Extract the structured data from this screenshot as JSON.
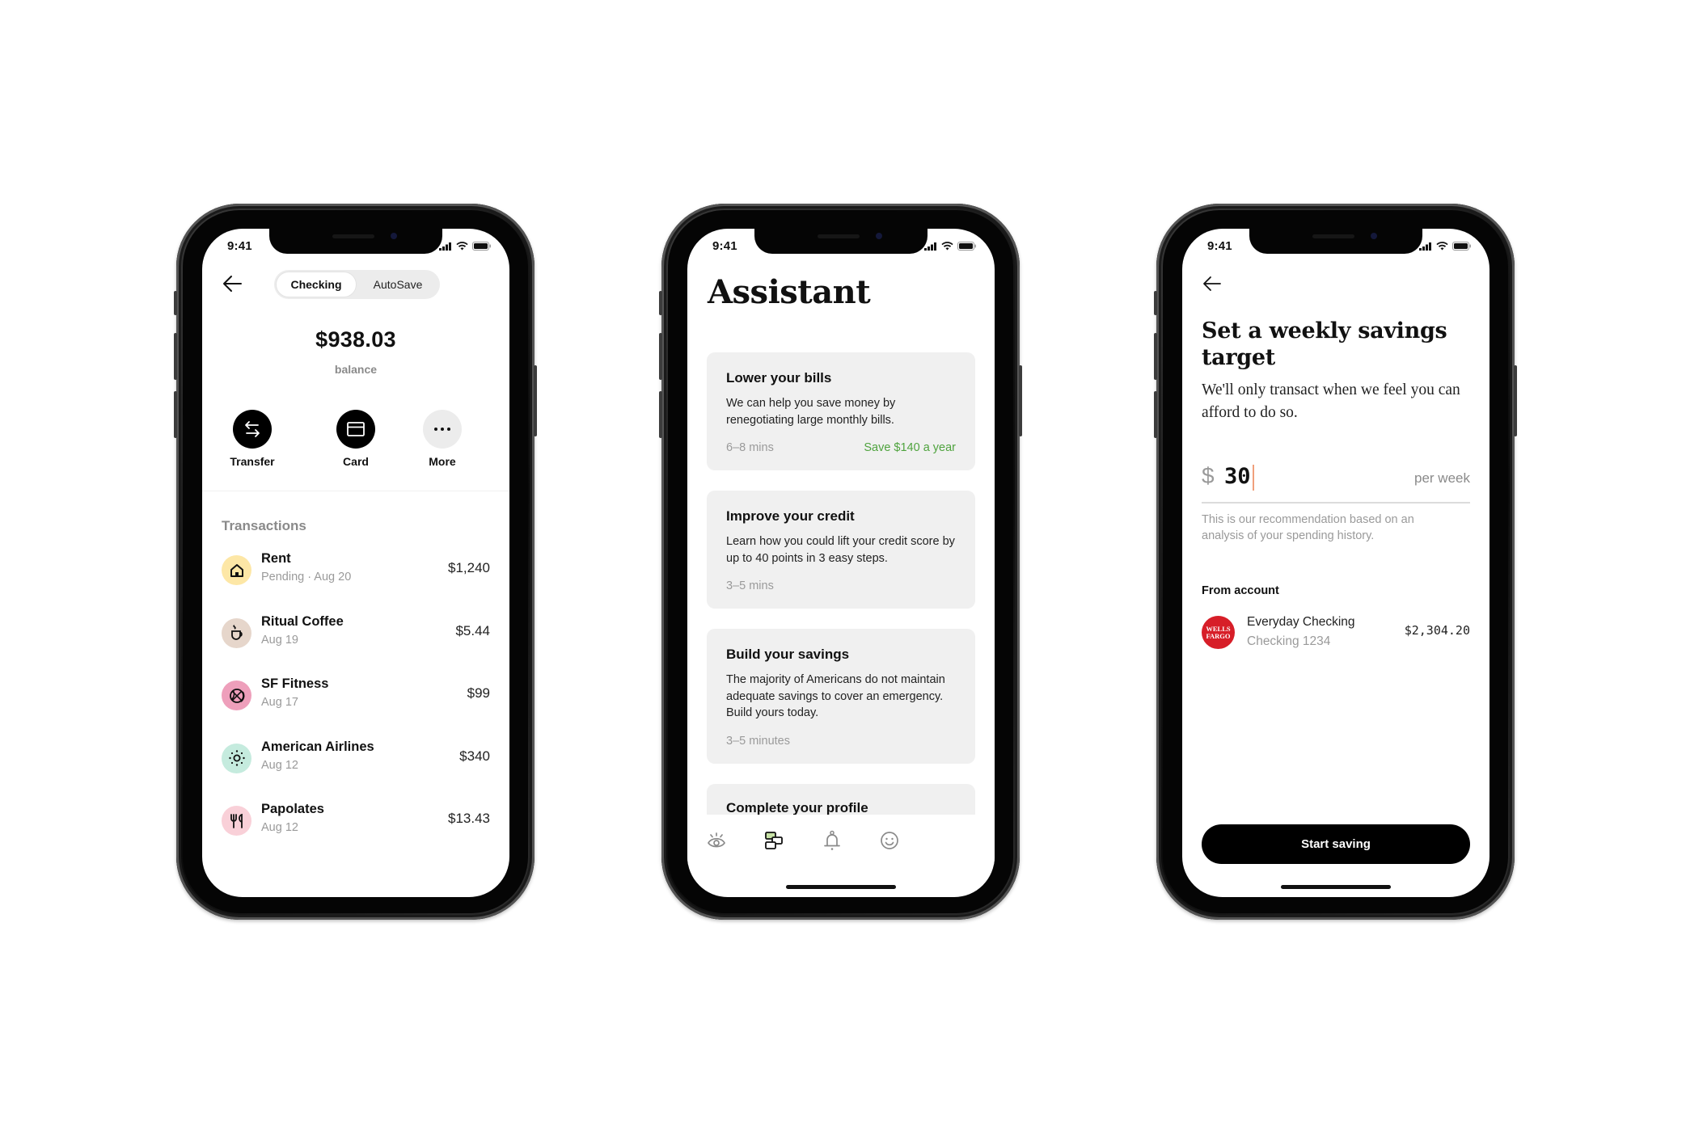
{
  "status_bar": {
    "time": "9:41"
  },
  "phone_account": {
    "segments": [
      {
        "label": "Checking",
        "active": true
      },
      {
        "label": "AutoSave",
        "active": false
      }
    ],
    "balance": "$938.03",
    "balance_label": "balance",
    "actions": [
      {
        "label": "Transfer",
        "icon": "transfer-arrows-icon"
      },
      {
        "label": "Card",
        "icon": "card-icon"
      },
      {
        "label": "More",
        "icon": "more-dots-icon"
      }
    ],
    "transactions_title": "Transactions",
    "transactions": [
      {
        "name": "Rent",
        "sub": "Pending · Aug 20",
        "amount": "$1,240",
        "icon": "house-icon",
        "color": "#fde7a6"
      },
      {
        "name": "Ritual Coffee",
        "sub": "Aug 19",
        "amount": "$5.44",
        "icon": "coffee-cup-icon",
        "color": "#e6d6cb"
      },
      {
        "name": "SF Fitness",
        "sub": "Aug 17",
        "amount": "$99",
        "icon": "basketball-icon",
        "color": "#ee9fbb"
      },
      {
        "name": "American Airlines",
        "sub": "Aug 12",
        "amount": "$340",
        "icon": "sun-icon",
        "color": "#c5ebde"
      },
      {
        "name": "Papolates",
        "sub": "Aug 12",
        "amount": "$13.43",
        "icon": "fork-knife-icon",
        "color": "#f9d0d8"
      }
    ]
  },
  "phone_assistant": {
    "title": "Assistant",
    "cards": [
      {
        "title": "Lower your bills",
        "body": "We can help you save money by renegotiating large monthly bills.",
        "duration": "6–8 mins",
        "savings": "Save $140 a year"
      },
      {
        "title": "Improve your credit",
        "body": "Learn how you could lift your credit score by up to 40 points in 3 easy steps.",
        "duration": "3–5 mins",
        "savings": ""
      },
      {
        "title": "Build your savings",
        "body": "The majority of Americans do not maintain adequate savings to cover an emergency. Build yours today.",
        "duration": "3–5 minutes",
        "savings": ""
      },
      {
        "title": "Complete your profile",
        "body": "",
        "duration": "",
        "savings": ""
      }
    ],
    "tabs": [
      {
        "name": "insights",
        "icon": "eye-icon",
        "active": false
      },
      {
        "name": "assistant",
        "icon": "cards-stack-icon",
        "active": true
      },
      {
        "name": "notifications",
        "icon": "bell-icon",
        "active": false
      },
      {
        "name": "profile",
        "icon": "smiley-icon",
        "active": false
      }
    ],
    "accent_color": "#4fa33e"
  },
  "phone_savings": {
    "title": "Set a weekly savings target",
    "subtitle": "We'll only transact when we feel you can afford to do so.",
    "currency_symbol": "$",
    "amount_value": "30",
    "amount_unit": "per week",
    "recommendation": "This is our recommendation based on an analysis of your spending history.",
    "from_account_label": "From account",
    "account": {
      "bank_logo_text": "WELLS FARGO",
      "name": "Everyday Checking",
      "number": "Checking 1234",
      "balance": "$2,304.20",
      "brand_color": "#d71e28"
    },
    "cta_label": "Start saving"
  }
}
